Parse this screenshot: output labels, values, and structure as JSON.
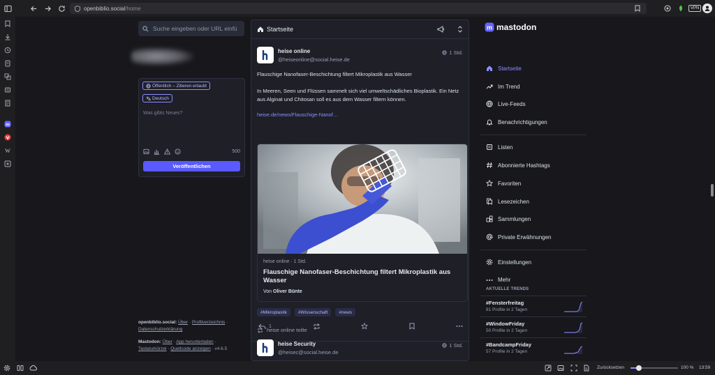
{
  "browser": {
    "url_host": "openbiblio.social",
    "url_path": "/home",
    "vpn_label": "VPN",
    "bottom": {
      "reset_label": "Zurücksetzen",
      "zoom": "100 %",
      "clock": "13:59"
    }
  },
  "left": {
    "search_placeholder": "Suche eingeben oder URL einfü",
    "compose": {
      "visibility": "Öffentlich – Zitieren erlaubt",
      "language": "Deutsch",
      "placeholder": "Was gibts Neues?",
      "char_count": "500",
      "publish_label": "Veröffentlichen"
    },
    "footer": {
      "line1_prefix": "openbiblio.social:",
      "line1_links": [
        "Über",
        "Profilverzeichnis"
      ],
      "line2": "Datenschutzerklärung",
      "line3_prefix": "Mastodon:",
      "line3_links": [
        "Über",
        "App herunterladen"
      ],
      "line4_links": [
        "Tastaturkürzel",
        "Quellcode anzeigen"
      ],
      "version": "v4.6.5"
    }
  },
  "timeline": {
    "title": "Startseite",
    "post1": {
      "name": "heise online",
      "handle": "@heiseonline@social.heise.de",
      "time": "1 Std.",
      "text1": "Flauschige Nanofaser-Beschichtung filtert Mikroplastik aus Wasser",
      "text2": "In Meeren, Seen und Flüssen sammelt sich viel umweltschädliches Bioplastik. Ein Netz aus Alginat und Chitosan soll es aus dem Wasser filtern können.",
      "link": "heise.de/news/Flauschige-Nanof…",
      "card": {
        "meta": "heise online · 1 Std.",
        "title": "Flauschige Nanofaser-Beschichtung filtert Mikroplastik aus Wasser",
        "author_prefix": "Von",
        "author": "Oliver Bünte"
      },
      "tags": [
        "#Mikroplastik",
        "#Wissenschaft",
        "#news"
      ],
      "reply_count": "1"
    },
    "boost_line": "heise online teilte",
    "post2": {
      "name": "heise Security",
      "handle": "@heisec@social.heise.de",
      "time": "1 Std."
    }
  },
  "nav": {
    "logo": "mastodon",
    "items": [
      {
        "label": "Startseite",
        "icon": "home-icon"
      },
      {
        "label": "Im Trend",
        "icon": "trending-icon"
      },
      {
        "label": "Live-Feeds",
        "icon": "globe-icon"
      },
      {
        "label": "Benachrichtigungen",
        "icon": "bell-icon"
      },
      {
        "label": "Listen",
        "icon": "list-icon"
      },
      {
        "label": "Abonnierte Hashtags",
        "icon": "hashtag-icon"
      },
      {
        "label": "Favoriten",
        "icon": "star-icon"
      },
      {
        "label": "Lesezeichen",
        "icon": "bookmark-icon"
      },
      {
        "label": "Sammlungen",
        "icon": "collections-icon"
      },
      {
        "label": "Private Erwähnungen",
        "icon": "at-icon"
      },
      {
        "label": "Einstellungen",
        "icon": "gear-icon"
      },
      {
        "label": "Mehr",
        "icon": "more-icon"
      }
    ],
    "trends_title": "AKTUELLE TRENDS",
    "trends": [
      {
        "tag": "#Fensterfreitag",
        "info": "81 Profile in 2 Tagen"
      },
      {
        "tag": "#WindowFriday",
        "info": "50 Profile in 2 Tagen"
      },
      {
        "tag": "#BandcampFriday",
        "info": "57 Profile in 2 Tagen"
      }
    ]
  }
}
